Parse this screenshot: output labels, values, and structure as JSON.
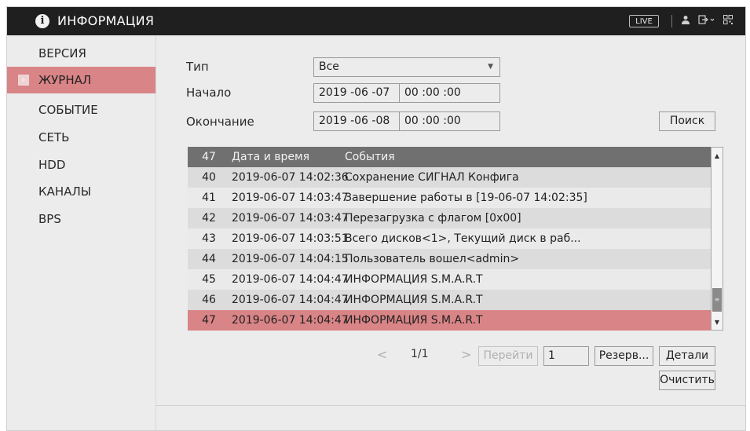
{
  "header": {
    "title": "ИНФОРМАЦИЯ",
    "live_label": "LIVE",
    "icons": [
      "info-icon",
      "user-icon",
      "logout-icon",
      "qr-code-icon"
    ]
  },
  "sidebar": {
    "items": [
      {
        "label": "ВЕРСИЯ"
      },
      {
        "label": "ЖУРНАЛ",
        "active": true
      },
      {
        "label": "СОБЫТИЕ"
      },
      {
        "label": "СЕТЬ"
      },
      {
        "label": "HDD"
      },
      {
        "label": "КАНАЛЫ"
      },
      {
        "label": "BPS"
      }
    ]
  },
  "filter": {
    "type_label": "Тип",
    "type_value": "Все",
    "start_label": "Начало",
    "start_date": "2019 -06 -07",
    "start_time": "00 :00 :00",
    "end_label": "Окончание",
    "end_date": "2019 -06 -08",
    "end_time": "00 :00 :00",
    "search_label": "Поиск"
  },
  "log_table": {
    "header": {
      "count": "47",
      "datetime": "Дата и время",
      "events": "События"
    },
    "rows": [
      {
        "num": "40",
        "datetime": "2019-06-07 14:02:36",
        "event": "Сохранение СИГНАЛ Конфига"
      },
      {
        "num": "41",
        "datetime": "2019-06-07 14:03:47",
        "event": "Завершение работы в [19-06-07 14:02:35]"
      },
      {
        "num": "42",
        "datetime": "2019-06-07 14:03:47",
        "event": "Перезагрузка с флагом [0x00]"
      },
      {
        "num": "43",
        "datetime": "2019-06-07 14:03:51",
        "event": "Всего дисков<1>, Текущий диск в раб..."
      },
      {
        "num": "44",
        "datetime": "2019-06-07 14:04:15",
        "event": "Пользователь вошел<admin>"
      },
      {
        "num": "45",
        "datetime": "2019-06-07 14:04:47",
        "event": "ИНФОРМАЦИЯ S.M.A.R.T"
      },
      {
        "num": "46",
        "datetime": "2019-06-07 14:04:47",
        "event": "ИНФОРМАЦИЯ S.M.A.R.T"
      },
      {
        "num": "47",
        "datetime": "2019-06-07 14:04:47",
        "event": "ИНФОРМАЦИЯ S.M.A.R.T",
        "selected": true
      }
    ]
  },
  "pagination": {
    "prev": "<",
    "page_info": "1/1",
    "next": ">",
    "goto_label": "Перейти",
    "goto_value": "1"
  },
  "actions": {
    "backup_label": "Резерв...",
    "details_label": "Детали",
    "clear_label": "Очистить"
  }
}
